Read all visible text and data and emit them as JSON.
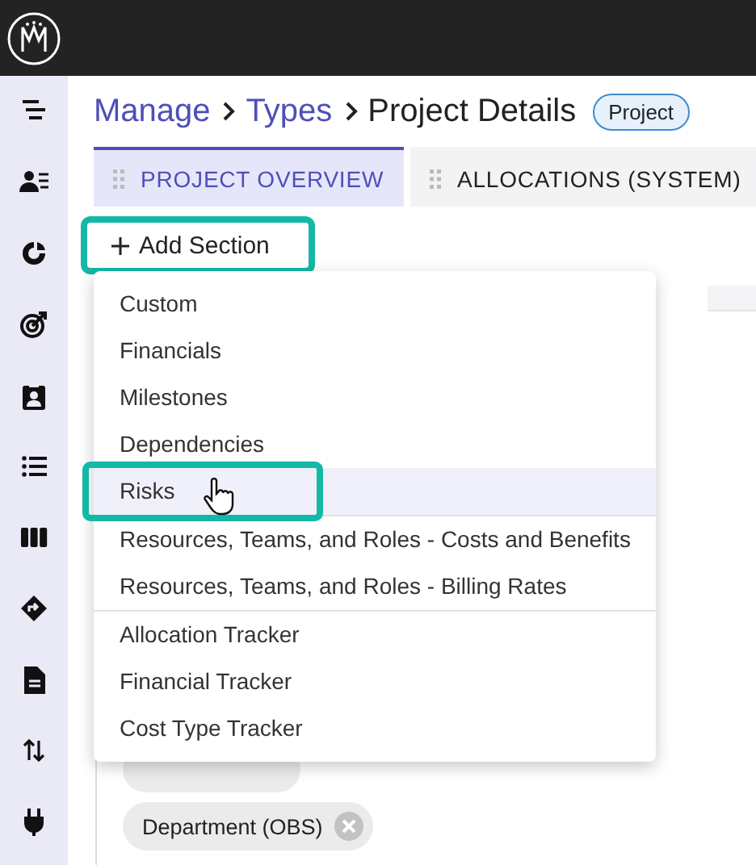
{
  "breadcrumb": [
    {
      "label": "Manage",
      "link": true
    },
    {
      "label": "Types",
      "link": true
    },
    {
      "label": "Project Details",
      "link": false
    }
  ],
  "badge": "Project",
  "tabs": [
    {
      "label": "PROJECT OVERVIEW",
      "selected": true
    },
    {
      "label": "ALLOCATIONS (SYSTEM)",
      "selected": false
    }
  ],
  "add_button": {
    "label": "Add Section",
    "highlighted": true
  },
  "menu": {
    "groups": [
      [
        {
          "label": "Custom",
          "hovered": false
        },
        {
          "label": "Financials",
          "hovered": false
        },
        {
          "label": "Milestones",
          "hovered": false
        },
        {
          "label": "Dependencies",
          "hovered": false
        },
        {
          "label": "Risks",
          "hovered": true
        }
      ],
      [
        {
          "label": "Resources, Teams, and Roles - Costs and Benefits",
          "hovered": false
        },
        {
          "label": "Resources, Teams, and Roles - Billing Rates",
          "hovered": false
        }
      ],
      [
        {
          "label": "Allocation Tracker",
          "hovered": false
        },
        {
          "label": "Financial Tracker",
          "hovered": false
        },
        {
          "label": "Cost Type Tracker",
          "hovered": false
        }
      ]
    ]
  },
  "chips": [
    {
      "label": "Department (OBS)"
    }
  ]
}
